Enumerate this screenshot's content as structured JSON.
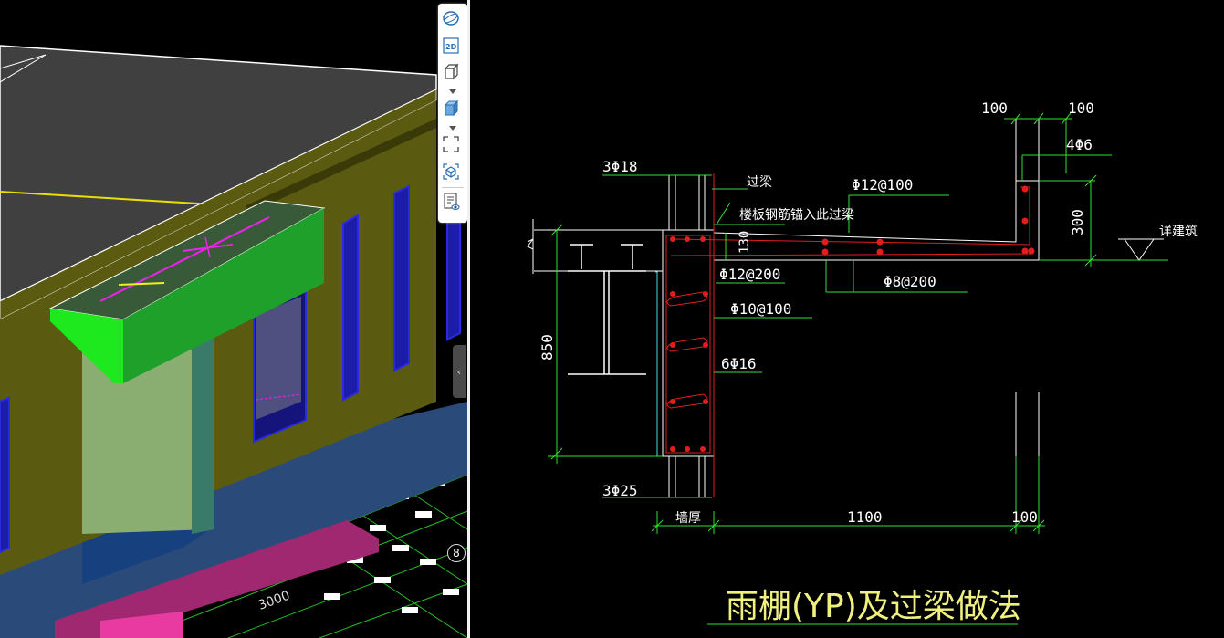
{
  "toolbar": {
    "items": [
      {
        "name": "dynamic-observe-icon"
      },
      {
        "name": "view-2d-icon",
        "label": "2D"
      },
      {
        "name": "view-3d-box-icon"
      },
      {
        "name": "view-3d-solid-icon"
      },
      {
        "name": "zoom-extent-icon"
      },
      {
        "name": "view-cube-icon"
      },
      {
        "name": "display-settings-icon"
      }
    ]
  },
  "viewport3d": {
    "axis_label": "8",
    "grid_text": "3000",
    "colors": {
      "slab": "#404040",
      "wall": "#5a5a10",
      "canopy": "#1fa02a",
      "column": "#8aad72",
      "pink": "#a02870",
      "window": "#1c1ca8"
    }
  },
  "drawing": {
    "title": "雨棚(YP)及过梁做法",
    "labels": {
      "top_dim_left": "100",
      "top_dim_right": "100",
      "stirrup_4": "4Φ6",
      "beam_top_bar": "3Φ18",
      "lintel": "过梁",
      "slab_anchor": "楼板钢筋锚入此过梁",
      "top_rebar": "Φ12@100",
      "dim_130": "130",
      "dim_300": "300",
      "arch": "详建筑",
      "rebar_200": "Φ12@200",
      "dist_bar": "Φ8@200",
      "stirrup": "Φ10@100",
      "side_bar": "6Φ16",
      "dim_850": "850",
      "bottom_bar": "3Φ25",
      "wall_thk": "墙厚",
      "dim_1100": "1100",
      "dim_100_bottom": "100"
    },
    "colors": {
      "dim": "#33e033",
      "concrete": "#ffffff",
      "rebar": "#e01e1e",
      "cyan": "#40e0e0"
    }
  }
}
